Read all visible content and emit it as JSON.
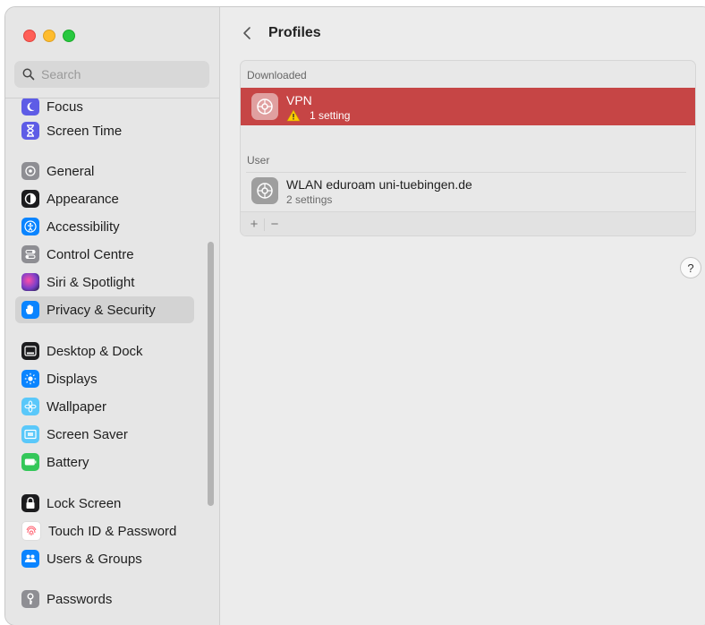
{
  "window": {
    "title": "Profiles"
  },
  "search": {
    "placeholder": "Search"
  },
  "sidebar": {
    "items": [
      {
        "label": "Focus",
        "icon": "moon-icon",
        "color": "#5e5ce6"
      },
      {
        "label": "Screen Time",
        "icon": "hourglass-icon",
        "color": "#5e5ce6"
      },
      {
        "label": "General",
        "icon": "gear-icon",
        "color": "#8e8e93"
      },
      {
        "label": "Appearance",
        "icon": "appearance-icon",
        "color": "#1c1c1e"
      },
      {
        "label": "Accessibility",
        "icon": "accessibility-icon",
        "color": "#0a84ff"
      },
      {
        "label": "Control Centre",
        "icon": "control-centre-icon",
        "color": "#8e8e93"
      },
      {
        "label": "Siri & Spotlight",
        "icon": "siri-icon",
        "color": "#7a3fc9"
      },
      {
        "label": "Privacy & Security",
        "icon": "hand-icon",
        "color": "#0a84ff"
      },
      {
        "label": "Desktop & Dock",
        "icon": "dock-icon",
        "color": "#1c1c1e"
      },
      {
        "label": "Displays",
        "icon": "sun-icon",
        "color": "#0a84ff"
      },
      {
        "label": "Wallpaper",
        "icon": "flower-icon",
        "color": "#5ac8fa"
      },
      {
        "label": "Screen Saver",
        "icon": "screen-saver-icon",
        "color": "#5ac8fa"
      },
      {
        "label": "Battery",
        "icon": "battery-icon",
        "color": "#34c759"
      },
      {
        "label": "Lock Screen",
        "icon": "lock-icon",
        "color": "#1c1c1e"
      },
      {
        "label": "Touch ID & Password",
        "icon": "fingerprint-icon",
        "color": "#ff6b6b"
      },
      {
        "label": "Users & Groups",
        "icon": "users-icon",
        "color": "#0a84ff"
      },
      {
        "label": "Passwords",
        "icon": "key-icon",
        "color": "#8e8e93"
      }
    ]
  },
  "main": {
    "title": "Profiles",
    "sections": [
      {
        "label": "Downloaded",
        "profiles": [
          {
            "name": "VPN",
            "sub": "1 setting",
            "warning": true,
            "selected": true
          }
        ]
      },
      {
        "label": "User",
        "profiles": [
          {
            "name": "WLAN eduroam uni-tuebingen.de",
            "sub": "2 settings",
            "warning": false,
            "selected": false
          }
        ]
      }
    ],
    "toolbar": {
      "add": "+",
      "remove": "−"
    },
    "help": "?"
  },
  "colors": {
    "selected_row": "#c64545",
    "sidebar_bg": "#e6e6e6",
    "main_bg": "#ececec"
  }
}
